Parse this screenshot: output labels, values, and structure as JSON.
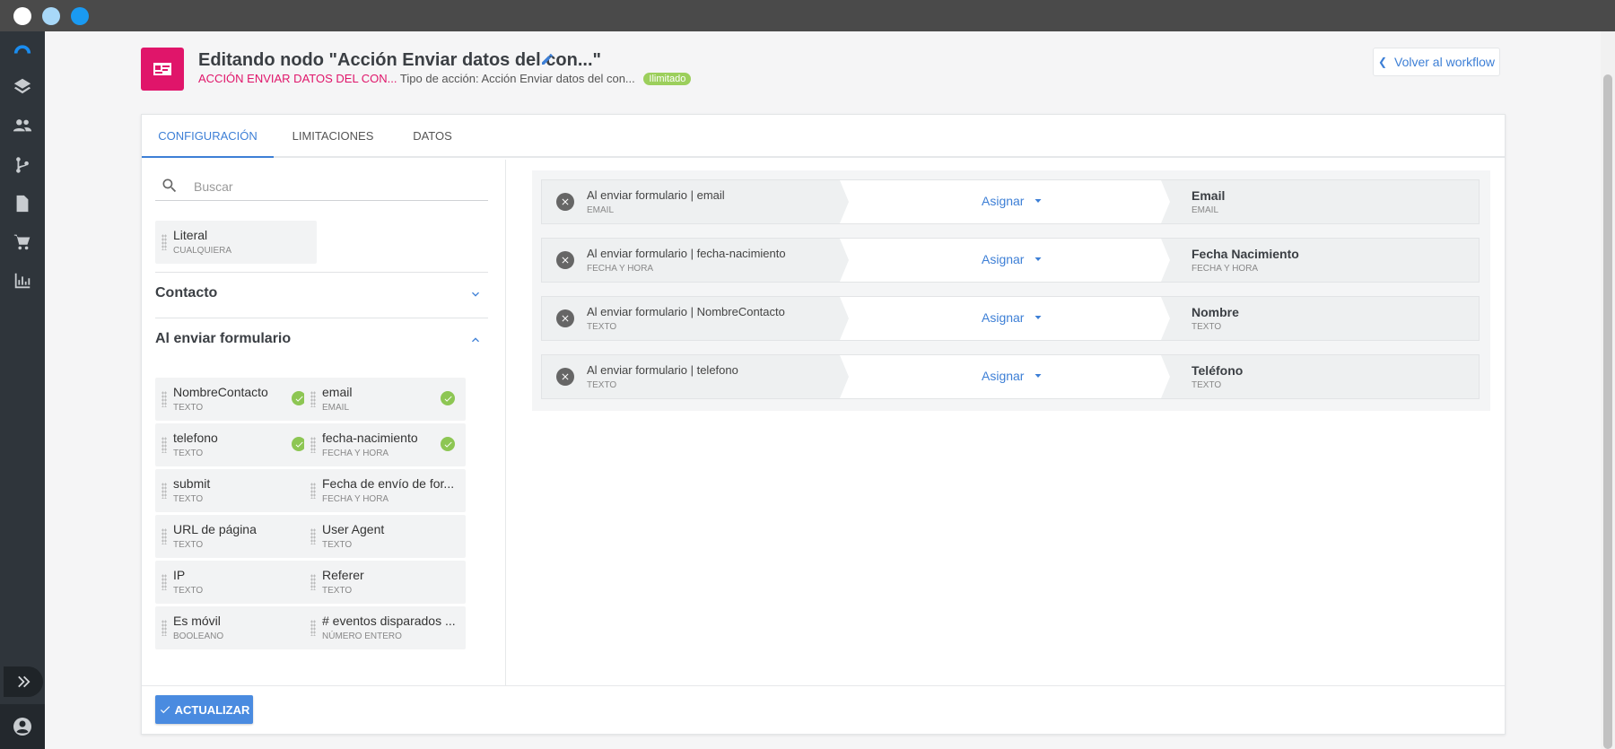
{
  "header": {
    "title": "Editando nodo \"Acción Enviar datos del con...\"",
    "type_label": "ACCIÓN ENVIAR DATOS DEL CON...",
    "type_desc": "Tipo de acción: Acción Enviar datos del con...",
    "badge": "Ilimitado",
    "back_label": "Volver al workflow"
  },
  "tabs": [
    {
      "label": "CONFIGURACIÓN",
      "active": true
    },
    {
      "label": "LIMITACIONES",
      "active": false
    },
    {
      "label": "DATOS",
      "active": false
    }
  ],
  "search": {
    "placeholder": "Buscar",
    "value": ""
  },
  "literal": {
    "name": "Literal",
    "type": "CUALQUIERA"
  },
  "sections": {
    "contacto": "Contacto",
    "formulario": "Al enviar formulario"
  },
  "fields": [
    {
      "name": "NombreContacto",
      "type": "TEXTO",
      "mapped": true
    },
    {
      "name": "email",
      "type": "EMAIL",
      "mapped": true
    },
    {
      "name": "telefono",
      "type": "TEXTO",
      "mapped": true
    },
    {
      "name": "fecha-nacimiento",
      "type": "FECHA Y HORA",
      "mapped": true
    },
    {
      "name": "submit",
      "type": "TEXTO",
      "mapped": false
    },
    {
      "name": "Fecha de envío de for...",
      "type": "FECHA Y HORA",
      "mapped": false
    },
    {
      "name": "URL de página",
      "type": "TEXTO",
      "mapped": false
    },
    {
      "name": "User Agent",
      "type": "TEXTO",
      "mapped": false
    },
    {
      "name": "IP",
      "type": "TEXTO",
      "mapped": false
    },
    {
      "name": "Referer",
      "type": "TEXTO",
      "mapped": false
    },
    {
      "name": "Es móvil",
      "type": "BOOLEANO",
      "mapped": false
    },
    {
      "name": "# eventos disparados ...",
      "type": "NÚMERO ENTERO",
      "mapped": false
    }
  ],
  "mappings": [
    {
      "source": "Al enviar formulario | email",
      "source_type": "EMAIL",
      "action": "Asignar",
      "target": "Email",
      "target_type": "EMAIL"
    },
    {
      "source": "Al enviar formulario | fecha-nacimiento",
      "source_type": "FECHA Y HORA",
      "action": "Asignar",
      "target": "Fecha Nacimiento",
      "target_type": "FECHA Y HORA"
    },
    {
      "source": "Al enviar formulario | NombreContacto",
      "source_type": "TEXTO",
      "action": "Asignar",
      "target": "Nombre",
      "target_type": "TEXTO"
    },
    {
      "source": "Al enviar formulario | telefono",
      "source_type": "TEXTO",
      "action": "Asignar",
      "target": "Teléfono",
      "target_type": "TEXTO"
    }
  ],
  "footer": {
    "update_label": "ACTUALIZAR"
  },
  "colors": {
    "accent": "#3d7fd6",
    "node": "#e0156a",
    "badge": "#9ccf5c",
    "check": "#8dc653"
  }
}
